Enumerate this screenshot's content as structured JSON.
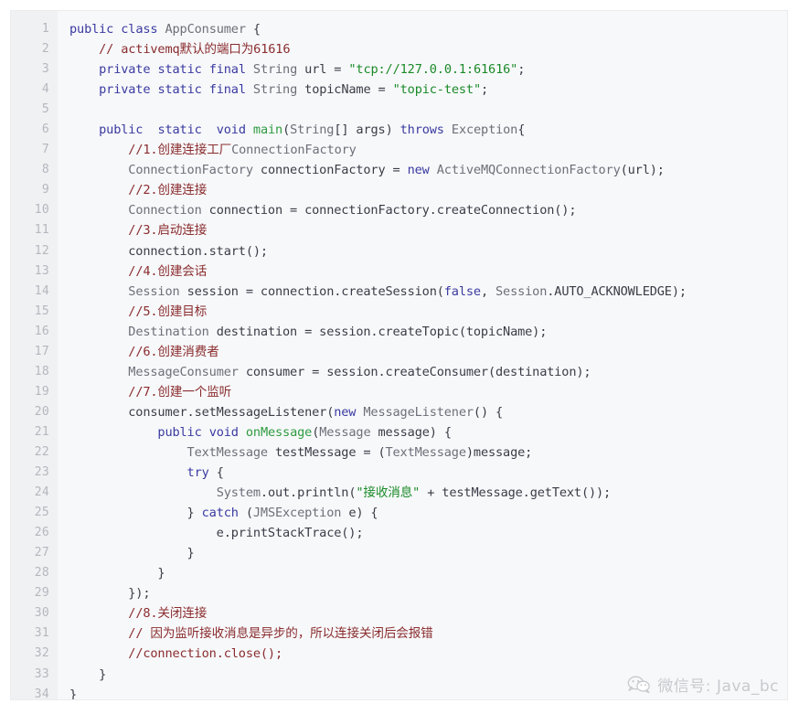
{
  "editor": {
    "language": "java",
    "background_color": "#f7f8fa",
    "gutter_color": "#f0f1f3",
    "line_number_color": "#b4b7bd",
    "first_line": 1,
    "last_line": 34,
    "colors": {
      "keyword": "#3a3aa0",
      "string": "#1a8a28",
      "comment": "#8a2c2e",
      "type": "#6e6e78",
      "method": "#2e9b3f",
      "plain": "#3b3b46"
    }
  },
  "watermark": {
    "icon": "wechat-icon",
    "text": "微信号: Java_bc"
  },
  "code": {
    "lines": [
      {
        "n": "1",
        "text": "public class AppConsumer {"
      },
      {
        "n": "2",
        "text": "    // activemq默认的端口为61616"
      },
      {
        "n": "3",
        "text": "    private static final String url = \"tcp://127.0.0.1:61616\";"
      },
      {
        "n": "4",
        "text": "    private static final String topicName = \"topic-test\";"
      },
      {
        "n": "5",
        "text": ""
      },
      {
        "n": "6",
        "text": "    public  static  void main(String[] args) throws Exception{"
      },
      {
        "n": "7",
        "text": "        //1.创建连接工厂ConnectionFactory"
      },
      {
        "n": "8",
        "text": "        ConnectionFactory connectionFactory = new ActiveMQConnectionFactory(url);"
      },
      {
        "n": "9",
        "text": "        //2.创建连接"
      },
      {
        "n": "10",
        "text": "        Connection connection = connectionFactory.createConnection();"
      },
      {
        "n": "11",
        "text": "        //3.启动连接"
      },
      {
        "n": "12",
        "text": "        connection.start();"
      },
      {
        "n": "13",
        "text": "        //4.创建会话"
      },
      {
        "n": "14",
        "text": "        Session session = connection.createSession(false, Session.AUTO_ACKNOWLEDGE);"
      },
      {
        "n": "15",
        "text": "        //5.创建目标"
      },
      {
        "n": "16",
        "text": "        Destination destination = session.createTopic(topicName);"
      },
      {
        "n": "17",
        "text": "        //6.创建消费者"
      },
      {
        "n": "18",
        "text": "        MessageConsumer consumer = session.createConsumer(destination);"
      },
      {
        "n": "19",
        "text": "        //7.创建一个监听"
      },
      {
        "n": "20",
        "text": "        consumer.setMessageListener(new MessageListener() {"
      },
      {
        "n": "21",
        "text": "            public void onMessage(Message message) {"
      },
      {
        "n": "22",
        "text": "                TextMessage testMessage = (TextMessage)message;"
      },
      {
        "n": "23",
        "text": "                try {"
      },
      {
        "n": "24",
        "text": "                    System.out.println(\"接收消息\" + testMessage.getText());"
      },
      {
        "n": "25",
        "text": "                } catch (JMSException e) {"
      },
      {
        "n": "26",
        "text": "                    e.printStackTrace();"
      },
      {
        "n": "27",
        "text": "                }"
      },
      {
        "n": "28",
        "text": "            }"
      },
      {
        "n": "29",
        "text": "        });"
      },
      {
        "n": "30",
        "text": "        //8.关闭连接"
      },
      {
        "n": "31",
        "text": "        // 因为监听接收消息是异步的，所以连接关闭后会报错"
      },
      {
        "n": "32",
        "text": "        //connection.close();"
      },
      {
        "n": "33",
        "text": "    }"
      },
      {
        "n": "34",
        "text": "}"
      }
    ],
    "tokens": [
      [
        [
          "kw",
          "public"
        ],
        [
          "plain",
          " "
        ],
        [
          "kw",
          "class"
        ],
        [
          "plain",
          " "
        ],
        [
          "type",
          "AppConsumer"
        ],
        [
          "plain",
          " {"
        ]
      ],
      [
        [
          "plain",
          "    "
        ],
        [
          "cmt",
          "// activemq默认的端口为61616"
        ]
      ],
      [
        [
          "plain",
          "    "
        ],
        [
          "kw",
          "private"
        ],
        [
          "plain",
          " "
        ],
        [
          "kw",
          "static"
        ],
        [
          "plain",
          " "
        ],
        [
          "kw",
          "final"
        ],
        [
          "plain",
          " "
        ],
        [
          "type",
          "String"
        ],
        [
          "plain",
          " url = "
        ],
        [
          "str",
          "\"tcp://127.0.0.1:61616\""
        ],
        [
          "plain",
          ";"
        ]
      ],
      [
        [
          "plain",
          "    "
        ],
        [
          "kw",
          "private"
        ],
        [
          "plain",
          " "
        ],
        [
          "kw",
          "static"
        ],
        [
          "plain",
          " "
        ],
        [
          "kw",
          "final"
        ],
        [
          "plain",
          " "
        ],
        [
          "type",
          "String"
        ],
        [
          "plain",
          " topicName = "
        ],
        [
          "str",
          "\"topic-test\""
        ],
        [
          "plain",
          ";"
        ]
      ],
      [
        [
          "plain",
          ""
        ]
      ],
      [
        [
          "plain",
          "    "
        ],
        [
          "kw",
          "public"
        ],
        [
          "plain",
          "  "
        ],
        [
          "kw",
          "static"
        ],
        [
          "plain",
          "  "
        ],
        [
          "kw",
          "void"
        ],
        [
          "plain",
          " "
        ],
        [
          "mth",
          "main"
        ],
        [
          "plain",
          "("
        ],
        [
          "type",
          "String"
        ],
        [
          "plain",
          "[] args) "
        ],
        [
          "kw",
          "throws"
        ],
        [
          "plain",
          " "
        ],
        [
          "type",
          "Exception"
        ],
        [
          "plain",
          "{"
        ]
      ],
      [
        [
          "plain",
          "        "
        ],
        [
          "cmt",
          "//1.创建连接工厂"
        ],
        [
          "type",
          "ConnectionFactory"
        ]
      ],
      [
        [
          "plain",
          "        "
        ],
        [
          "type",
          "ConnectionFactory"
        ],
        [
          "plain",
          " connectionFactory = "
        ],
        [
          "kw",
          "new"
        ],
        [
          "plain",
          " "
        ],
        [
          "type",
          "ActiveMQConnectionFactory"
        ],
        [
          "plain",
          "(url);"
        ]
      ],
      [
        [
          "plain",
          "        "
        ],
        [
          "cmt",
          "//2.创建连接"
        ]
      ],
      [
        [
          "plain",
          "        "
        ],
        [
          "type",
          "Connection"
        ],
        [
          "plain",
          " connection = connectionFactory.createConnection();"
        ]
      ],
      [
        [
          "plain",
          "        "
        ],
        [
          "cmt",
          "//3.启动连接"
        ]
      ],
      [
        [
          "plain",
          "        connection.start();"
        ]
      ],
      [
        [
          "plain",
          "        "
        ],
        [
          "cmt",
          "//4.创建会话"
        ]
      ],
      [
        [
          "plain",
          "        "
        ],
        [
          "type",
          "Session"
        ],
        [
          "plain",
          " session = connection.createSession("
        ],
        [
          "kw",
          "false"
        ],
        [
          "plain",
          ", "
        ],
        [
          "type",
          "Session"
        ],
        [
          "plain",
          ".AUTO_ACKNOWLEDGE);"
        ]
      ],
      [
        [
          "plain",
          "        "
        ],
        [
          "cmt",
          "//5.创建目标"
        ]
      ],
      [
        [
          "plain",
          "        "
        ],
        [
          "type",
          "Destination"
        ],
        [
          "plain",
          " destination = session.createTopic(topicName);"
        ]
      ],
      [
        [
          "plain",
          "        "
        ],
        [
          "cmt",
          "//6.创建消费者"
        ]
      ],
      [
        [
          "plain",
          "        "
        ],
        [
          "type",
          "MessageConsumer"
        ],
        [
          "plain",
          " consumer = session.createConsumer(destination);"
        ]
      ],
      [
        [
          "plain",
          "        "
        ],
        [
          "cmt",
          "//7.创建一个监听"
        ]
      ],
      [
        [
          "plain",
          "        consumer.setMessageListener("
        ],
        [
          "kw",
          "new"
        ],
        [
          "plain",
          " "
        ],
        [
          "type",
          "MessageListener"
        ],
        [
          "plain",
          "() {"
        ]
      ],
      [
        [
          "plain",
          "            "
        ],
        [
          "kw",
          "public"
        ],
        [
          "plain",
          " "
        ],
        [
          "kw",
          "void"
        ],
        [
          "plain",
          " "
        ],
        [
          "mth",
          "onMessage"
        ],
        [
          "plain",
          "("
        ],
        [
          "type",
          "Message"
        ],
        [
          "plain",
          " message) {"
        ]
      ],
      [
        [
          "plain",
          "                "
        ],
        [
          "type",
          "TextMessage"
        ],
        [
          "plain",
          " testMessage = ("
        ],
        [
          "type",
          "TextMessage"
        ],
        [
          "plain",
          ")message;"
        ]
      ],
      [
        [
          "plain",
          "                "
        ],
        [
          "kw",
          "try"
        ],
        [
          "plain",
          " {"
        ]
      ],
      [
        [
          "plain",
          "                    "
        ],
        [
          "type",
          "System"
        ],
        [
          "plain",
          ".out.println("
        ],
        [
          "str",
          "\"接收消息\""
        ],
        [
          "plain",
          " + testMessage.getText());"
        ]
      ],
      [
        [
          "plain",
          "                } "
        ],
        [
          "kw",
          "catch"
        ],
        [
          "plain",
          " ("
        ],
        [
          "type",
          "JMSException"
        ],
        [
          "plain",
          " e) {"
        ]
      ],
      [
        [
          "plain",
          "                    e.printStackTrace();"
        ]
      ],
      [
        [
          "plain",
          "                }"
        ]
      ],
      [
        [
          "plain",
          "            }"
        ]
      ],
      [
        [
          "plain",
          "        });"
        ]
      ],
      [
        [
          "plain",
          "        "
        ],
        [
          "cmt",
          "//8.关闭连接"
        ]
      ],
      [
        [
          "plain",
          "        "
        ],
        [
          "cmt",
          "// 因为监听接收消息是异步的，所以连接关闭后会报错"
        ]
      ],
      [
        [
          "plain",
          "        "
        ],
        [
          "cmt",
          "//connection.close();"
        ]
      ],
      [
        [
          "plain",
          "    }"
        ]
      ],
      [
        [
          "plain",
          "}"
        ]
      ]
    ]
  }
}
